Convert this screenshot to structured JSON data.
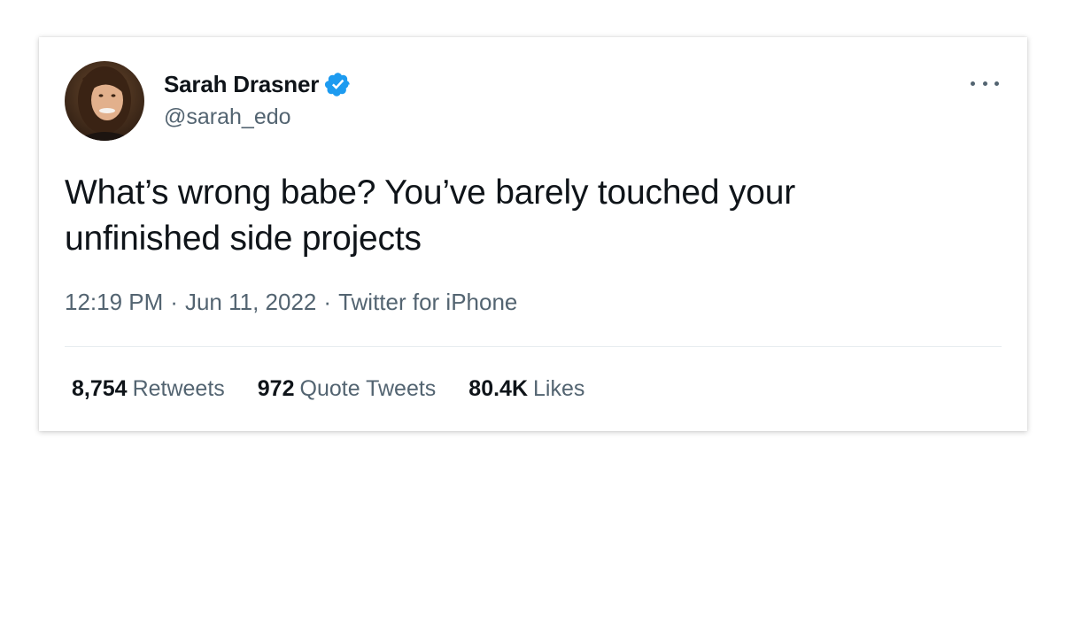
{
  "tweet": {
    "author": {
      "display_name": "Sarah Drasner",
      "handle": "@sarah_edo",
      "verified": true,
      "avatar_icon": "profile-photo"
    },
    "more_icon": "more-dots-icon",
    "text_line1": "What’s wrong babe? You’ve barely touched your",
    "text_line2": "unfinished side projects",
    "meta": {
      "time": "12:19 PM",
      "separator": "·",
      "date": "Jun 11, 2022",
      "source": "Twitter for iPhone"
    },
    "stats": [
      {
        "value": "8,754",
        "label": "Retweets"
      },
      {
        "value": "972",
        "label": "Quote Tweets"
      },
      {
        "value": "80.4K",
        "label": "Likes"
      }
    ]
  },
  "colors": {
    "verified_blue": "#1d9bf0",
    "text_primary": "#0f1419",
    "text_secondary": "#536471",
    "divider": "#e7ecf0"
  }
}
